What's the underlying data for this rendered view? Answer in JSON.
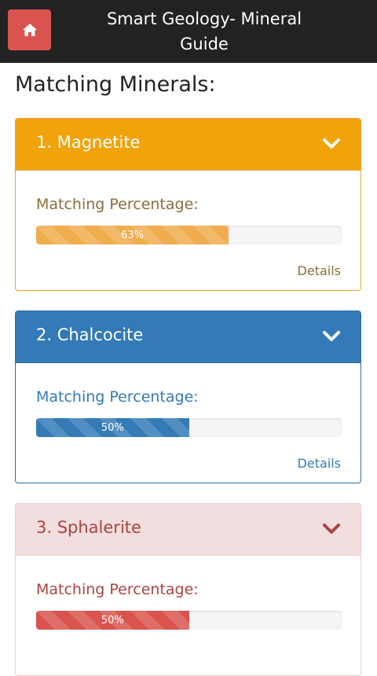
{
  "header": {
    "title_line1": "Smart Geology- Mineral",
    "title_line2": "Guide",
    "home_icon": "home-icon",
    "home_color": "#d9534f",
    "bar_color": "#222222"
  },
  "heading": "Matching Minerals:",
  "minerals": [
    {
      "title": "1. Magnetite",
      "label": "Matching Percentage:",
      "percent_text": "63%",
      "percent": 63,
      "details": "Details",
      "color": "#f0a30a"
    },
    {
      "title": "2. Chalcocite",
      "label": "Matching Percentage:",
      "percent_text": "50%",
      "percent": 50,
      "details": "Details",
      "color": "#337ab7"
    },
    {
      "title": "3. Sphalerite",
      "label": "Matching Percentage:",
      "percent_text": "50%",
      "percent": 50,
      "color": "#d9534f"
    }
  ]
}
